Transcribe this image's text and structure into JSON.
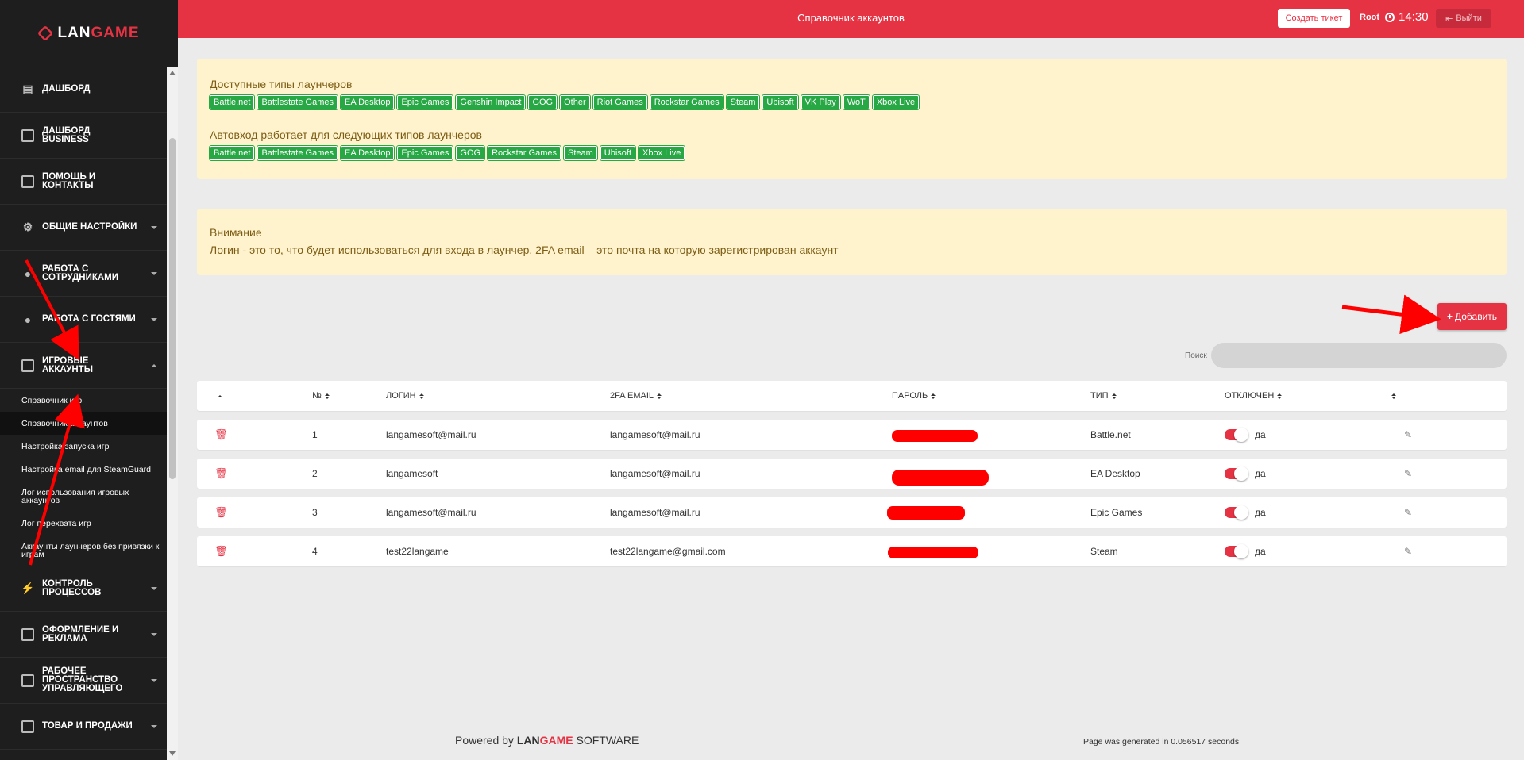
{
  "logo": {
    "part1": "LAN",
    "part2": "GAME"
  },
  "sidebar": {
    "items": [
      {
        "label": "Дашборд"
      },
      {
        "label": "Дашборд business"
      },
      {
        "label": "Помощь и контакты"
      },
      {
        "label": "Общие настройки"
      },
      {
        "label": "Работа с сотрудниками"
      },
      {
        "label": "Работа с гостями"
      },
      {
        "label": "Игровые аккаунты"
      },
      {
        "label": "Контроль процессов"
      },
      {
        "label": "Оформление и реклама"
      },
      {
        "label": "Рабочее пространство управляющего"
      },
      {
        "label": "Товар и продажи"
      }
    ],
    "subitems": [
      {
        "label": "Справочник игр"
      },
      {
        "label": "Справочник аккаунтов"
      },
      {
        "label": "Настройка запуска игр"
      },
      {
        "label": "Настройка email для SteamGuard"
      },
      {
        "label": "Лог использования игровых аккаунтов"
      },
      {
        "label": "Лог перехвата игр"
      },
      {
        "label": "Аккаунты лаунчеров без привязки к играм"
      }
    ]
  },
  "header": {
    "title": "Справочник аккаунтов",
    "ticket_button": "Создать тикет",
    "user": "Root",
    "time": "14:30",
    "logout": "Выйти"
  },
  "info": {
    "launchers_title": "Доступные типы лаунчеров",
    "launchers": [
      "Battle.net",
      "Battlestate Games",
      "EA Desktop",
      "Epic Games",
      "Genshin Impact",
      "GOG",
      "Other",
      "Riot Games",
      "Rockstar Games",
      "Steam",
      "Ubisoft",
      "VK Play",
      "WoT",
      "Xbox Live"
    ],
    "autologin_title": "Автовход работает для следующих типов лаунчеров",
    "autologin": [
      "Battle.net",
      "Battlestate Games",
      "EA Desktop",
      "Epic Games",
      "GOG",
      "Rockstar Games",
      "Steam",
      "Ubisoft",
      "Xbox Live"
    ]
  },
  "notice": {
    "title": "Внимание",
    "text": "Логин - это то, что будет использоваться для входа в лаунчер, 2FA email – это почта на которую зарегистрирован аккаунт"
  },
  "add_button": "Добавить",
  "search": {
    "label": "Поиск",
    "placeholder": ""
  },
  "table": {
    "columns": [
      "№",
      "ЛОГИН",
      "2FA EMAIL",
      "ПАРОЛЬ",
      "ТИП",
      "ОТКЛЮЧЕН"
    ],
    "rows": [
      {
        "num": "1",
        "login": "langamesoft@mail.ru",
        "email": "langamesoft@mail.ru",
        "type": "Battle.net",
        "disabled": "да"
      },
      {
        "num": "2",
        "login": "langamesoft",
        "email": "langamesoft@mail.ru",
        "type": "EA Desktop",
        "disabled": "да"
      },
      {
        "num": "3",
        "login": "langamesoft@mail.ru",
        "email": "langamesoft@mail.ru",
        "type": "Epic Games",
        "disabled": "да"
      },
      {
        "num": "4",
        "login": "test22langame",
        "email": "test22langame@gmail.com",
        "type": "Steam",
        "disabled": "да"
      }
    ]
  },
  "footer": {
    "powered": "Powered by",
    "brand1": "LAN",
    "brand2": "GAME",
    "software": "SOFTWARE",
    "generated": "Page was generated in 0.056517 seconds"
  },
  "colors": {
    "accent": "#e53344",
    "tag": "#28a745",
    "notice_bg": "#fef3cd",
    "annotation": "#ff0000"
  }
}
